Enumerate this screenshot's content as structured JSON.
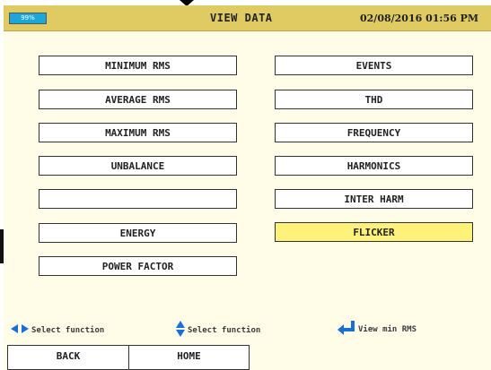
{
  "header": {
    "battery_text": "99%",
    "battery_level": 0.99,
    "title": "VIEW DATA",
    "datetime": "02/08/2016 01:56 PM"
  },
  "menu": {
    "left": [
      "MINIMUM RMS",
      "AVERAGE RMS",
      "MAXIMUM RMS",
      "UNBALANCE",
      "",
      "ENERGY",
      "POWER FACTOR"
    ],
    "right": [
      "EVENTS",
      "THD",
      "FREQUENCY",
      "HARMONICS",
      "INTER HARM",
      "FLICKER"
    ],
    "selected": "FLICKER"
  },
  "help": {
    "left_right": "Select function",
    "up_down": "Select function",
    "enter": "View min RMS"
  },
  "softkeys": [
    "BACK",
    "HOME",
    ""
  ],
  "colors": {
    "title_bar": "#e0cb62",
    "screen_bg": "#fffde8",
    "selected_bg": "#fff27a",
    "icon_blue": "#1a6fd6",
    "battery": "#1aa7dc"
  },
  "icons": {
    "left_right": "left-right-arrows-icon",
    "up_down": "up-down-arrows-icon",
    "enter": "enter-key-icon",
    "battery": "battery-icon"
  }
}
